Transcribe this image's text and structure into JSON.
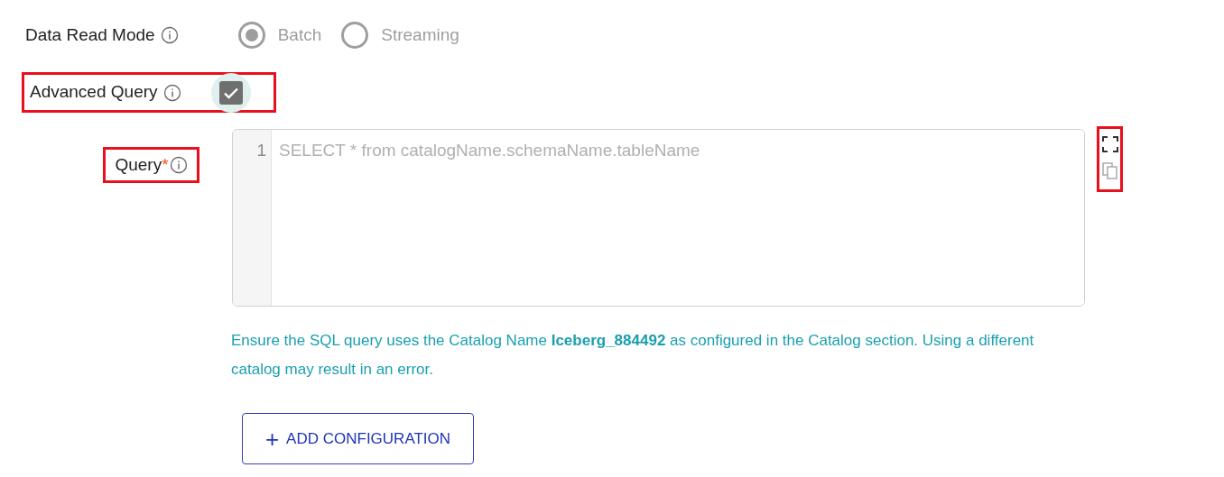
{
  "read_mode": {
    "label": "Data Read Mode",
    "options": [
      {
        "label": "Batch",
        "selected": true,
        "disabled": true
      },
      {
        "label": "Streaming",
        "selected": false,
        "disabled": true
      }
    ]
  },
  "advanced_query": {
    "label": "Advanced Query",
    "checked": true,
    "highlighted": true
  },
  "query": {
    "label": "Query",
    "required_mark": "*",
    "highlighted": true,
    "line_numbers": [
      "1"
    ],
    "placeholder": "SELECT * from catalogName.schemaName.tableName",
    "tools_highlighted": true
  },
  "help_text": "Ensure the SQL query uses the Catalog Name **Iceberg_884492** as configured in the Catalog section. Using a different catalog may result in an error.",
  "add_button": {
    "icon": "+",
    "label": "ADD CONFIGURATION"
  }
}
